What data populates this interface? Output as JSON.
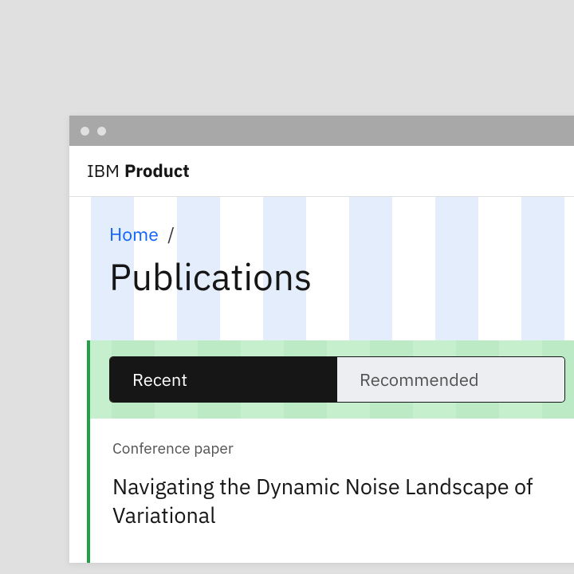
{
  "brand": {
    "light": "IBM",
    "bold": "Product"
  },
  "breadcrumb": {
    "home": "Home",
    "sep": "/"
  },
  "page": {
    "title": "Publications"
  },
  "tabs": {
    "recent": "Recent",
    "recommended": "Recommended"
  },
  "card": {
    "label": "Conference paper",
    "title": "Navigating the Dynamic Noise Landscape of Variational"
  }
}
